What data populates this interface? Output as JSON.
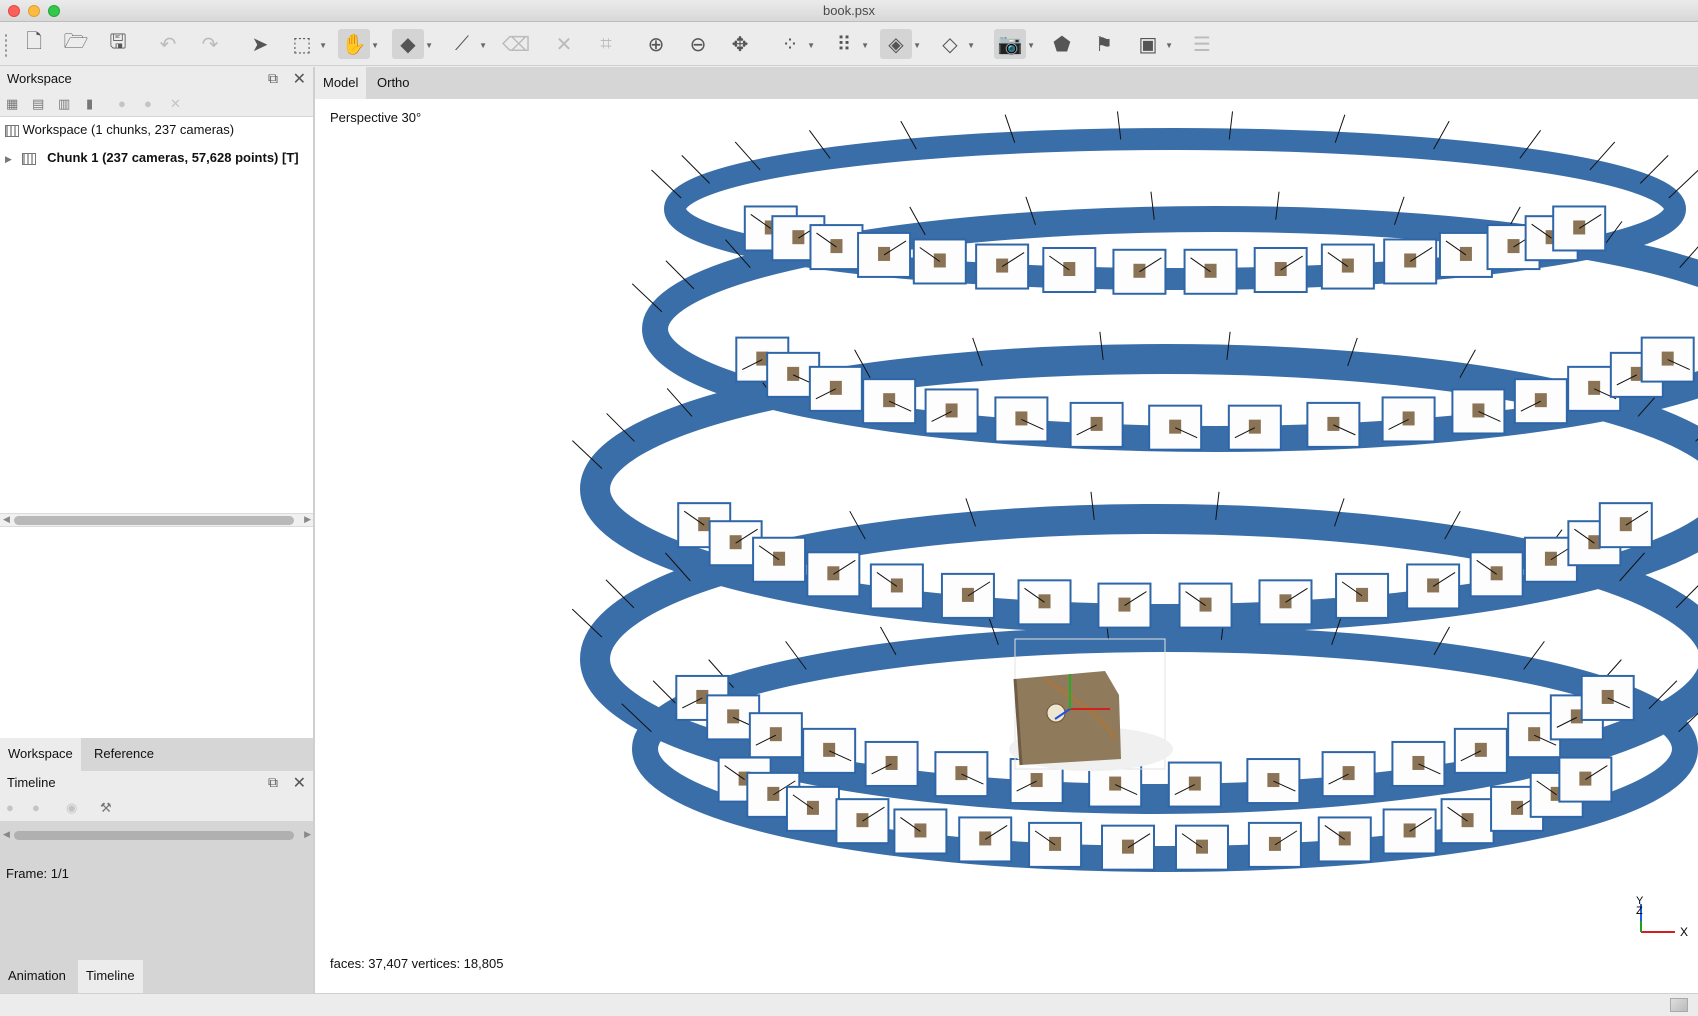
{
  "window": {
    "title": "book.psx"
  },
  "toolbar": {
    "icons": [
      "new-icon",
      "open-icon",
      "save-icon",
      "undo-icon",
      "redo-icon",
      "pointer-icon",
      "rectangle-select-icon",
      "navigate-icon",
      "rotate-object-icon",
      "ruler-icon",
      "eraser-icon",
      "delete-icon",
      "crop-icon",
      "zoom-in-icon",
      "zoom-out-icon",
      "fit-icon",
      "points-icon",
      "dense-points-icon",
      "mesh-icon",
      "shaded-mesh-icon",
      "camera-icon",
      "model-icon",
      "marker-icon",
      "dem-icon",
      "layers-icon"
    ]
  },
  "workspace_panel": {
    "title": "Workspace",
    "tree": {
      "root": "Workspace (1 chunks, 237 cameras)",
      "chunk": "Chunk 1 (237 cameras, 57,628 points) [T]"
    }
  },
  "left_tabs": {
    "workspace": "Workspace",
    "reference": "Reference"
  },
  "timeline_panel": {
    "title": "Timeline",
    "frame": "Frame: 1/1"
  },
  "bottom_tabs": {
    "animation": "Animation",
    "timeline": "Timeline"
  },
  "view_tabs": {
    "model": "Model",
    "ortho": "Ortho"
  },
  "viewport": {
    "projection": "Perspective 30°",
    "stats": "faces: 37,407 vertices: 18,805",
    "axes": {
      "y": "Y",
      "z": "Z",
      "x": "X"
    }
  },
  "colors": {
    "camera_band": "#3a6ea8",
    "frame_border": "#2f66a8",
    "object": "#8b7355"
  }
}
